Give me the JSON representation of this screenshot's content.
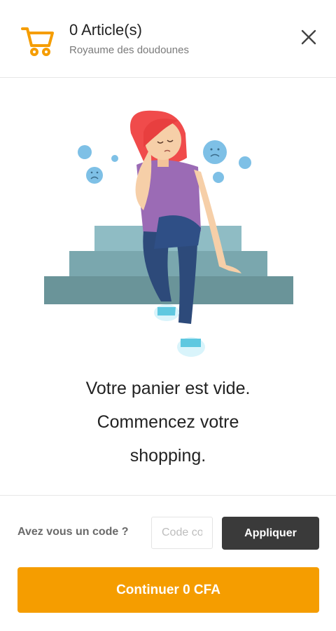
{
  "header": {
    "title": "0 Article(s)",
    "subtitle": "Royaume des doudounes",
    "cart_icon": "shopping-cart-icon",
    "close_icon": "close-icon"
  },
  "illustration": {
    "description_icon": "sad-girl-on-stairs-illustration"
  },
  "empty_cart": {
    "line1": "Votre panier est vide.",
    "line2": "Commencez votre",
    "line3": "shopping."
  },
  "promo": {
    "label": "Avez vous un code ?",
    "input_value": "",
    "input_placeholder": "Code coupon",
    "apply_label": "Appliquer"
  },
  "checkout": {
    "continue_label": "Continuer 0 CFA"
  },
  "colors": {
    "accent": "#f59d00",
    "dark_button": "#3a3a3a"
  }
}
